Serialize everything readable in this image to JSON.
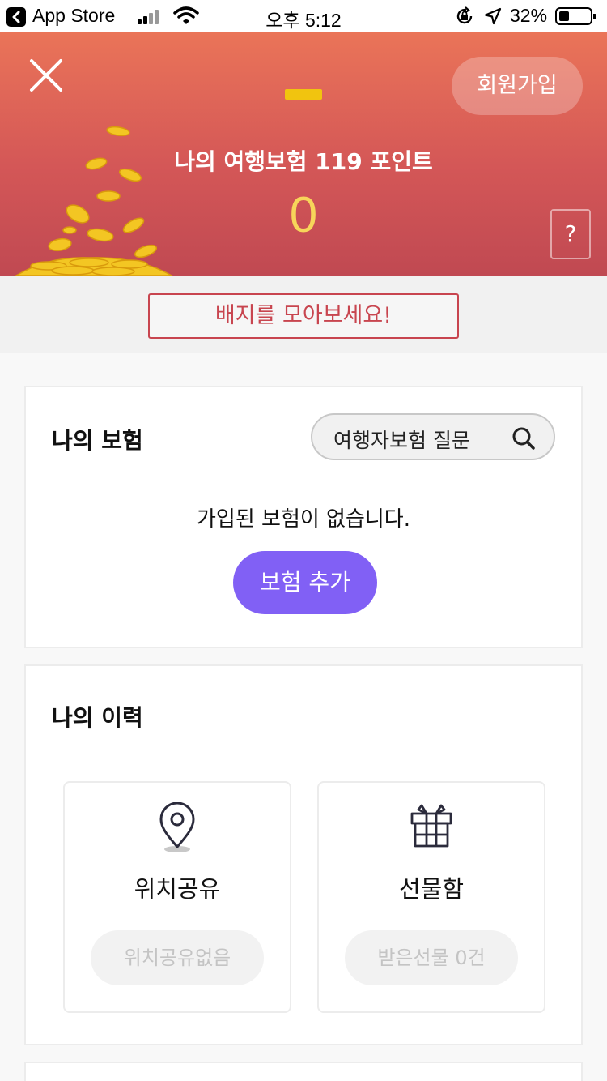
{
  "status_bar": {
    "back_app": "App Store",
    "time": "오후 5:12",
    "battery_pct": "32%",
    "battery_level": 0.32,
    "icons": [
      "signal-icon",
      "wifi-icon",
      "orientation-lock-icon",
      "location-arrow-icon",
      "battery-icon"
    ]
  },
  "header": {
    "signup_label": "회원가입",
    "points_title": "나의 여행보험 119 포인트",
    "points_value": "0",
    "help_label": "?",
    "colors": {
      "gradient_top": "#ea7458",
      "gradient_bottom": "#c04952",
      "points": "#f7d55a",
      "gold": "#f1c40f"
    }
  },
  "badge_button": {
    "label": "배지를 모아보세요!",
    "color": "#c8454f"
  },
  "insurance": {
    "title": "나의 보험",
    "search_label": "여행자보험 질문",
    "empty_message": "가입된 보험이 없습니다.",
    "add_label": "보험 추가",
    "accent": "#8160f5"
  },
  "history": {
    "title": "나의 이력",
    "tiles": [
      {
        "label": "위치공유",
        "status": "위치공유없음",
        "icon": "map-pin-icon"
      },
      {
        "label": "선물함",
        "status": "받은선물 0건",
        "icon": "gift-icon"
      }
    ]
  }
}
